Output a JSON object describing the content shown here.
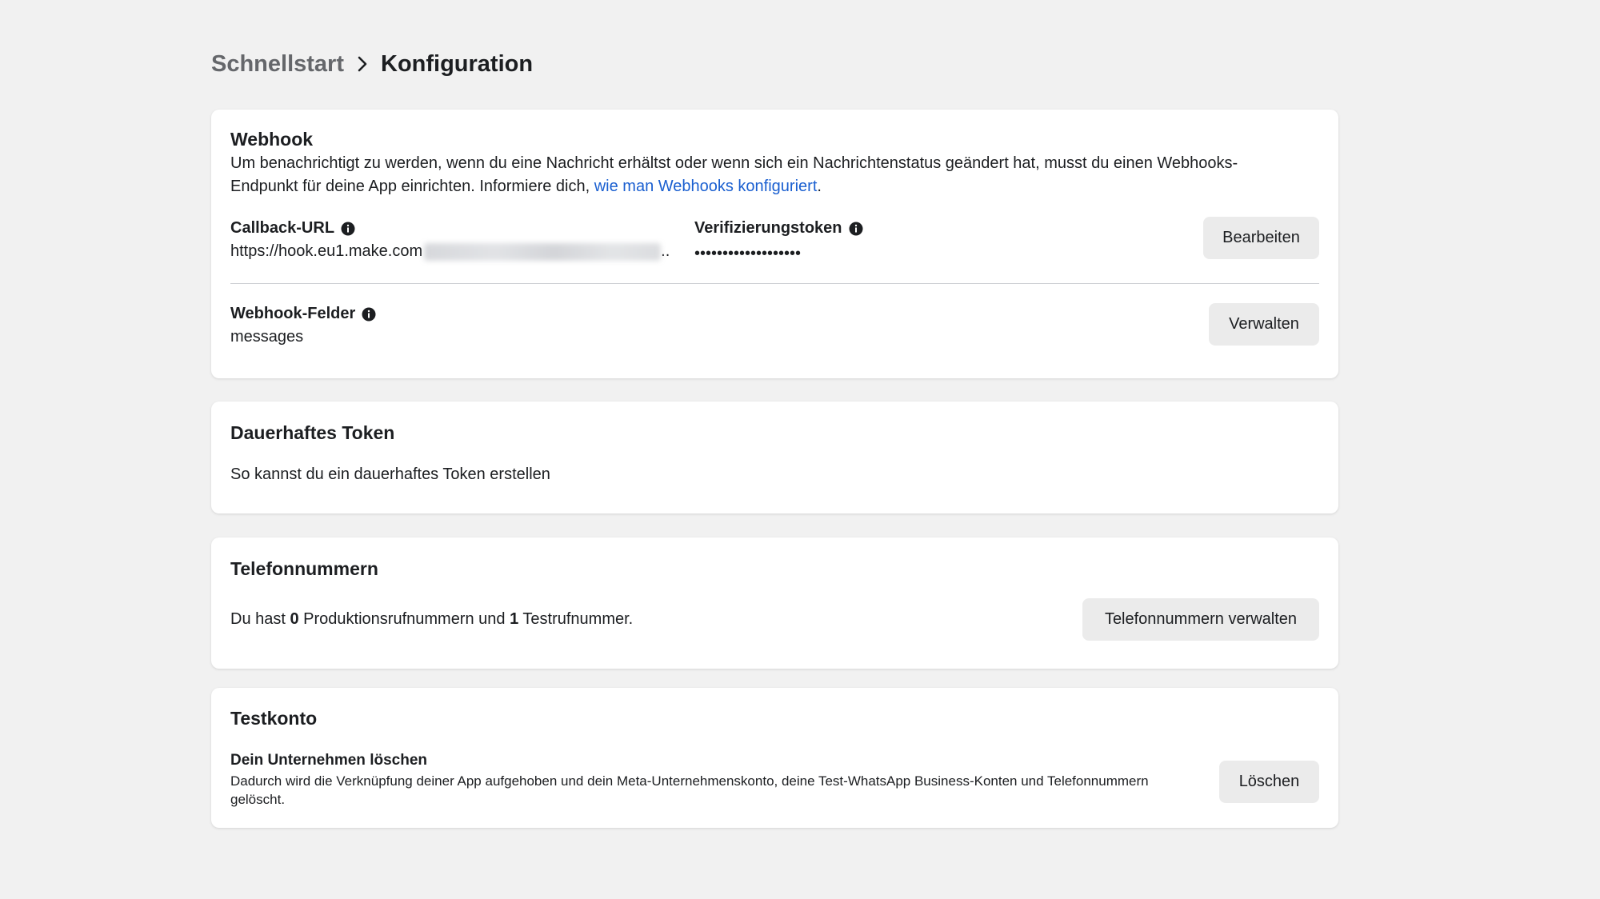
{
  "breadcrumb": {
    "previous": "Schnellstart",
    "current": "Konfiguration"
  },
  "webhook": {
    "title": "Webhook",
    "description_text": "Um benachrichtigt zu werden, wenn du eine Nachricht erhältst oder wenn sich ein Nachrichtenstatus geändert hat, musst du einen Webhooks-Endpunkt für deine App einrichten. Informiere dich, ",
    "description_link": "wie man Webhooks konfiguriert",
    "description_end": ".",
    "callback_label": "Callback-URL",
    "callback_value": "https://hook.eu1.make.com",
    "callback_ellipsis": "..",
    "token_label": "Verifizierungstoken",
    "token_value": "•••••••••••••••••••",
    "edit_button": "Bearbeiten",
    "fields_label": "Webhook-Felder",
    "fields_value": "messages",
    "manage_button": "Verwalten"
  },
  "token": {
    "title": "Dauerhaftes Token",
    "link": "So kannst du ein dauerhaftes Token erstellen"
  },
  "phones": {
    "title": "Telefonnummern",
    "text_1": "Du hast ",
    "production_count": "0",
    "text_2": " Produktionsrufnummern und ",
    "test_count": "1",
    "text_3": " Testrufnummer.",
    "manage_button": "Telefonnummern verwalten"
  },
  "test_account": {
    "title": "Testkonto",
    "delete_heading": "Dein Unternehmen löschen",
    "delete_description": "Dadurch wird die Verknüpfung deiner App aufgehoben und dein Meta-Unternehmenskonto, deine Test-WhatsApp Business-Konten und Telefonnummern gelöscht.",
    "delete_button": "Löschen"
  },
  "colors": {
    "background": "#f1f1f1",
    "card": "#ffffff",
    "link": "#1a5fd0",
    "button": "#ebebeb",
    "muted_text": "#65676b"
  },
  "icons": [
    "chevron-right-icon",
    "info-icon"
  ]
}
